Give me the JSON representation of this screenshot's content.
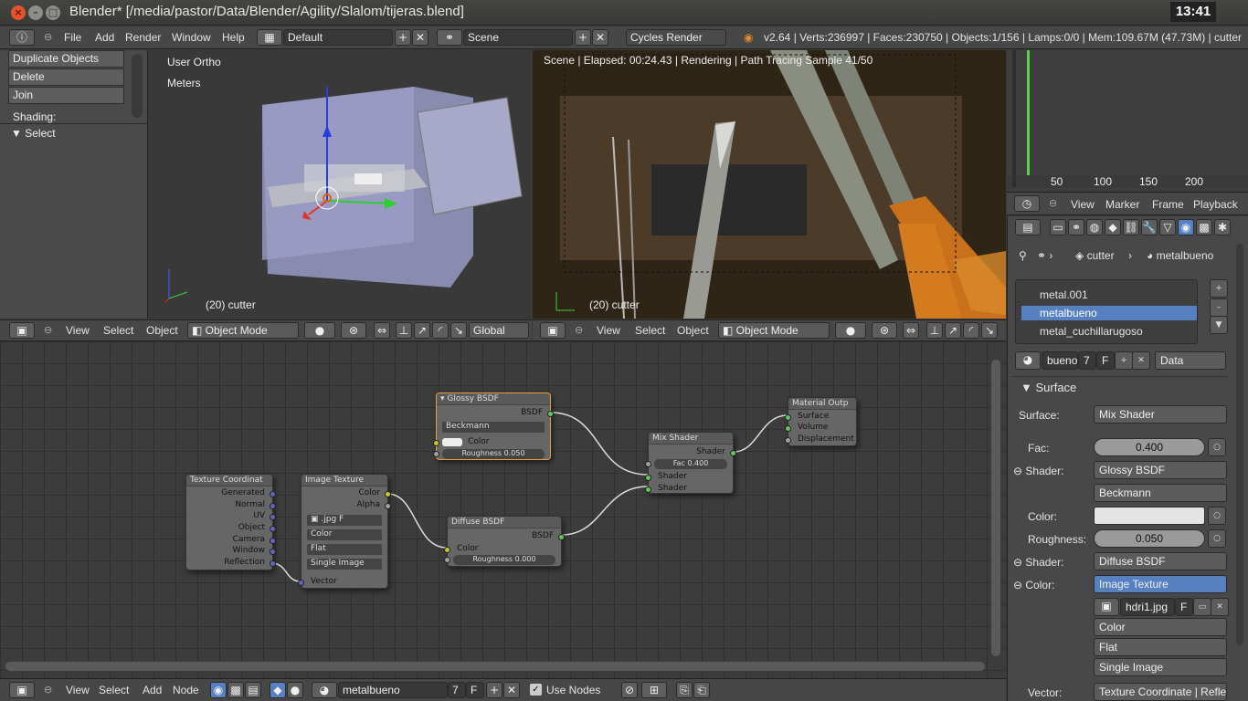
{
  "window": {
    "title": "Blender* [/media/pastor/Data/Blender/Agility/Slalom/tijeras.blend]",
    "clock": "13:41",
    "close": "×",
    "minimize": "–",
    "maximize": "□"
  },
  "infobar": {
    "menus": [
      "File",
      "Add",
      "Render",
      "Window",
      "Help"
    ],
    "layout": "Default",
    "scene": "Scene",
    "engine": "Cycles Render",
    "stats": "v2.64 | Verts:236997 | Faces:230750 | Objects:1/156 | Lamps:0/0 | Mem:109.67M (47.73M) | cutter"
  },
  "toolshelf": {
    "buttons": [
      "Duplicate Objects",
      "Delete",
      "Join"
    ],
    "shading": "Shading:",
    "select_panel": "Select"
  },
  "viewport_left": {
    "view": "User Ortho",
    "units": "Meters",
    "object": "(20) cutter"
  },
  "viewport_right": {
    "status": "Scene | Elapsed: 00:24.43 | Rendering | Path Tracing Sample 41/50",
    "object": "(20) cutter"
  },
  "header3d": {
    "menus": [
      "View",
      "Select",
      "Object"
    ],
    "mode": "Object Mode",
    "orientation": "Global"
  },
  "nodes": {
    "texcoord": {
      "title": "Texture Coordinat",
      "outputs": [
        "Generated",
        "Normal",
        "UV",
        "Object",
        "Camera",
        "Window",
        "Reflection"
      ]
    },
    "imagetex": {
      "title": "Image Texture",
      "outputs": [
        "Color",
        "Alpha"
      ],
      "file": ".jpg",
      "f": "F",
      "color": "Color",
      "proj": "Flat",
      "source": "Single Image",
      "input": "Vector"
    },
    "glossy": {
      "title": "Glossy BSDF",
      "output": "BSDF",
      "dist": "Beckmann",
      "color": "Color",
      "rough": "Roughness 0.050"
    },
    "diffuse": {
      "title": "Diffuse BSDF",
      "output": "BSDF",
      "color": "Color",
      "rough": "Roughness 0.000"
    },
    "mix": {
      "title": "Mix Shader",
      "output": "Shader",
      "fac": "Fac 0.400",
      "in1": "Shader",
      "in2": "Shader"
    },
    "matout": {
      "title": "Material Outp",
      "inputs": [
        "Surface",
        "Volume",
        "Displacement"
      ]
    }
  },
  "timeline": {
    "ticks": [
      "50",
      "100",
      "150",
      "200"
    ],
    "menus": [
      "View",
      "Marker",
      "Frame",
      "Playback"
    ]
  },
  "props": {
    "breadcrumb": {
      "object": "cutter",
      "material": "metalbueno"
    },
    "materials": [
      "metal.001",
      "metalbueno",
      "metal_cuchillarugoso"
    ],
    "matname": "bueno",
    "users": "7",
    "f": "F",
    "link": "Data",
    "surface_panel": "Surface",
    "surface_label": "Surface:",
    "surface_val": "Mix Shader",
    "fac_label": "Fac:",
    "fac_val": "0.400",
    "shader1_label": "Shader:",
    "shader1_val": "Glossy BSDF",
    "dist": "Beckmann",
    "color_label": "Color:",
    "rough_label": "Roughness:",
    "rough_val": "0.050",
    "shader2_label": "Shader:",
    "shader2_val": "Diffuse BSDF",
    "color2_label": "Color:",
    "color2_val": "Image Texture",
    "image": "hdri1.jpg",
    "image_f": "F",
    "colorspace": "Color",
    "projection": "Flat",
    "source": "Single Image",
    "vector_label": "Vector:",
    "vector_val": "Texture Coordinate | Reflecti"
  },
  "nodebar": {
    "menus": [
      "View",
      "Select",
      "Add",
      "Node"
    ],
    "material": "metalbueno",
    "users": "7",
    "f": "F",
    "use_nodes": "Use Nodes"
  }
}
